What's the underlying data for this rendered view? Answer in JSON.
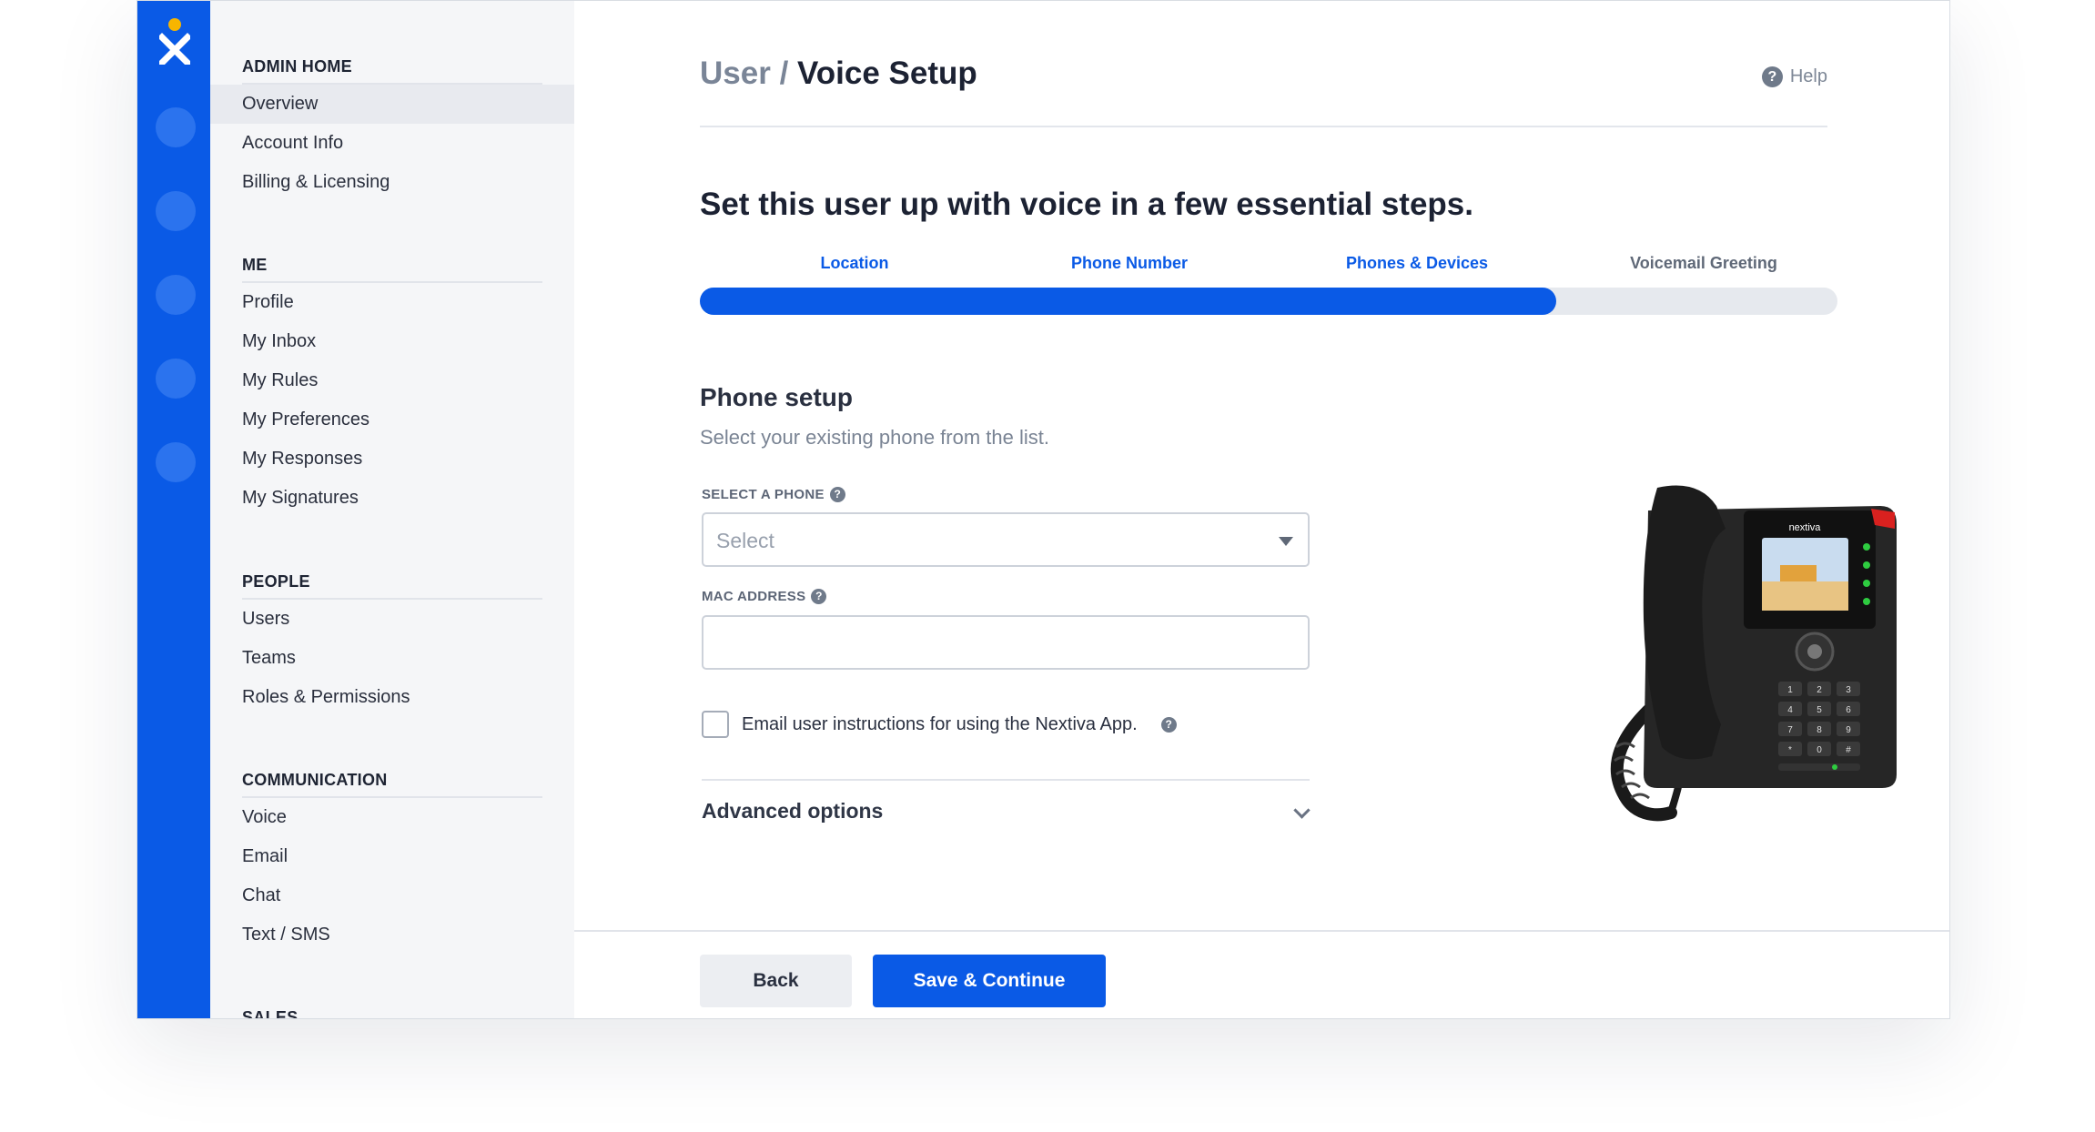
{
  "sidebar": {
    "sections": [
      {
        "title": "ADMIN HOME",
        "items": [
          "Overview",
          "Account Info",
          "Billing & Licensing"
        ]
      },
      {
        "title": "ME",
        "items": [
          "Profile",
          "My Inbox",
          "My Rules",
          "My Preferences",
          "My Responses",
          "My Signatures"
        ]
      },
      {
        "title": "PEOPLE",
        "items": [
          "Users",
          "Teams",
          "Roles & Permissions"
        ]
      },
      {
        "title": "COMMUNICATION",
        "items": [
          "Voice",
          "Email",
          "Chat",
          "Text / SMS"
        ]
      },
      {
        "title": "SALES",
        "items": []
      }
    ],
    "active_item": "Overview"
  },
  "header": {
    "breadcrumb_parent": "User",
    "breadcrumb_sep": "/",
    "breadcrumb_current": "Voice Setup",
    "help_label": "Help"
  },
  "wizard": {
    "headline": "Set this user up with voice in a few essential steps.",
    "steps": [
      {
        "label": "Location",
        "state": "complete"
      },
      {
        "label": "Phone Number",
        "state": "complete"
      },
      {
        "label": "Phones & Devices",
        "state": "current"
      },
      {
        "label": "Voicemail Greeting",
        "state": "upcoming"
      }
    ],
    "progress_fraction": 0.753
  },
  "form": {
    "title": "Phone setup",
    "subtitle": "Select your existing phone from the list.",
    "select_label": "SELECT A PHONE",
    "select_placeholder": "Select",
    "mac_label": "MAC ADDRESS",
    "mac_value": "",
    "email_checkbox_label": "Email user instructions for using the Nextiva App.",
    "email_checkbox_checked": false,
    "advanced_label": "Advanced options"
  },
  "phone_image": {
    "brand": "nextiva",
    "keys": [
      "1",
      "2",
      "3",
      "4",
      "5",
      "6",
      "7",
      "8",
      "9",
      "*",
      "0",
      "#"
    ]
  },
  "footer": {
    "back_label": "Back",
    "save_label": "Save & Continue"
  },
  "colors": {
    "brand_blue": "#0a5ae6",
    "logo_yellow": "#f7b500"
  },
  "icons": {
    "help": "help-circle-icon",
    "select_caret": "caret-down-icon",
    "advanced_chevron": "chevron-down-icon"
  }
}
